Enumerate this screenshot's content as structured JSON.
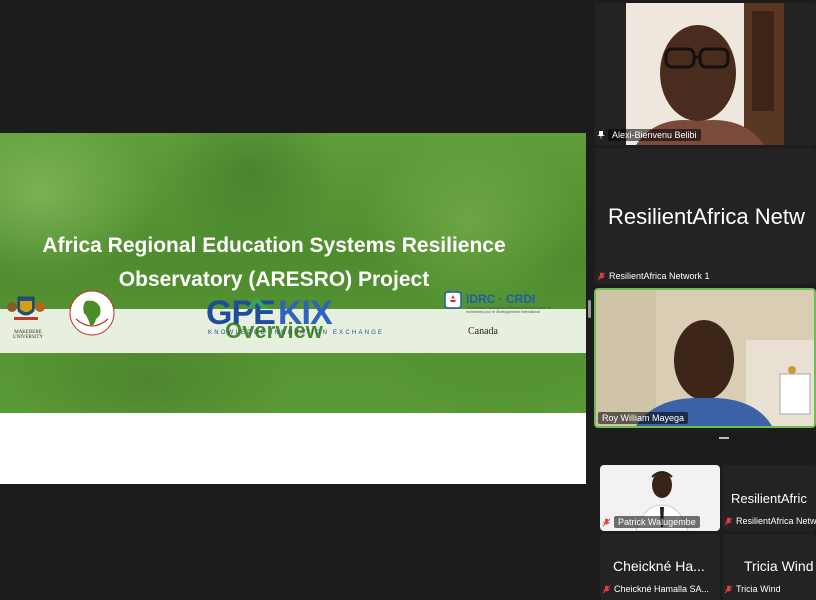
{
  "slide": {
    "title_line1": "Africa Regional Education Systems Resilience",
    "title_line2": "Observatory (ARESRO) Project",
    "subtitle": "Overview",
    "logos": {
      "makerere": "MAKERERE UNIVERSITY",
      "gpe": "GPE",
      "kix": "KIX",
      "gpe_tagline": "KNOWLEDGE INNOVATION EXCHANGE",
      "idrc": "IDRC · CRDI",
      "idrc_sub": "International Development Research Centre Centre de recherches pour le développement international",
      "canada": "Canada"
    }
  },
  "participants": {
    "p1": {
      "name": "Alexi-Bienvenu Belibi"
    },
    "p2": {
      "big_name": "ResilientAfrica Netw",
      "name": "ResilientAfrica Network 1"
    },
    "p3": {
      "name": "Roy William Mayega"
    },
    "p4": {
      "name": "Patrick Walugembe"
    },
    "p5": {
      "big_name": "ResilientAfric",
      "name": "ResilientAfrica Netw"
    },
    "p6": {
      "big_name": "Cheickné Ha...",
      "name": "Cheickné Hamalla SA..."
    },
    "p7": {
      "big_name": "Tricia Wind",
      "name": "Tricia Wind"
    }
  },
  "colors": {
    "slide_green": "#5a9a35",
    "overview_green": "#4c8a2b",
    "active_border": "#6dbd4f",
    "mic_off": "#e0433f"
  }
}
